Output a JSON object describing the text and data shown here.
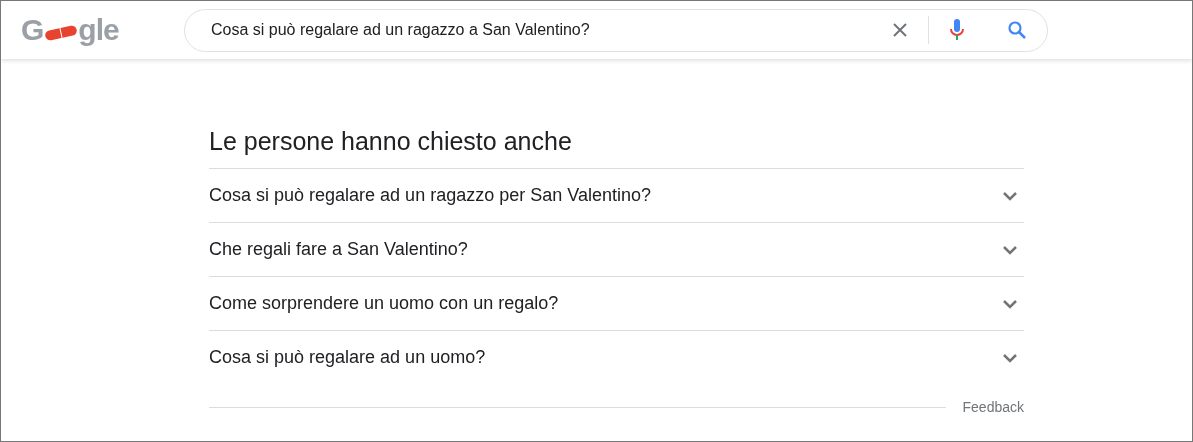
{
  "header": {
    "logo_parts": [
      "G",
      "gle"
    ],
    "search": {
      "value": "Cosa si può regalare ad un ragazzo a San Valentino?"
    }
  },
  "people_also_ask": {
    "title": "Le persone hanno chiesto anche",
    "questions": [
      {
        "text": "Cosa si può regalare ad un ragazzo per San Valentino?",
        "expanded": false
      },
      {
        "text": "Che regali fare a San Valentino?",
        "expanded": false
      },
      {
        "text": "Come sorprendere un uomo con un regalo?",
        "expanded": false
      },
      {
        "text": "Cosa si può regalare ad un uomo?",
        "expanded": false
      }
    ],
    "feedback": "Feedback"
  }
}
